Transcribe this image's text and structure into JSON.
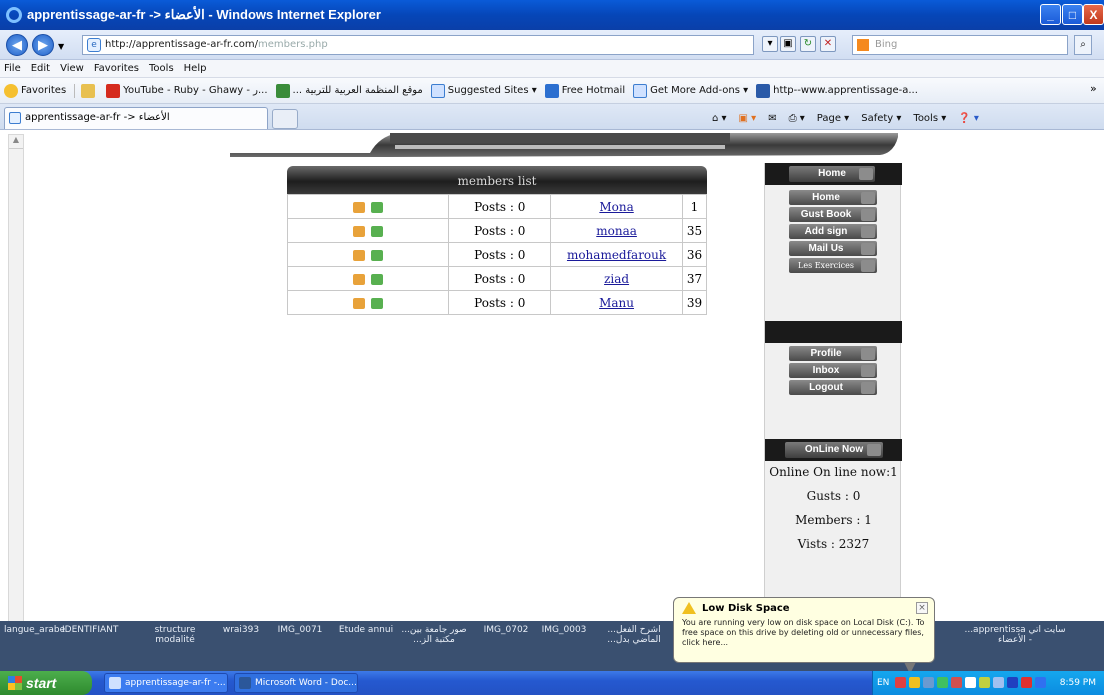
{
  "window": {
    "title": "apprentissage-ar-fr -> الأعضاء - Windows Internet Explorer",
    "minimize": "_",
    "maximize": "□",
    "close": "X"
  },
  "address_bar": {
    "url_host": "http://apprentissage-ar-fr.com/",
    "url_path": "members.php",
    "search_placeholder": "Bing"
  },
  "menu": [
    "File",
    "Edit",
    "View",
    "Favorites",
    "Tools",
    "Help"
  ],
  "favorites_bar": {
    "favorites_label": "Favorites",
    "items": [
      "YouTube - Ruby - Ghawy - ر...",
      "... موقع المنظمة العربية للتربية",
      "Suggested Sites ▾",
      "Free Hotmail",
      "Get More Add-ons ▾",
      "http--www.apprentissage-a..."
    ],
    "overflow": "»"
  },
  "tab": {
    "label": "apprentissage-ar-fr -> الأعضاء"
  },
  "command_bar": [
    "Page ▾",
    "Safety ▾",
    "Tools ▾"
  ],
  "members": {
    "header": "members list",
    "rows": [
      {
        "posts": "Posts : 0",
        "name": "Mona",
        "id": "1"
      },
      {
        "posts": "Posts : 0",
        "name": "monaa",
        "id": "35"
      },
      {
        "posts": "Posts : 0",
        "name": "mohamedfarouk",
        "id": "36"
      },
      {
        "posts": "Posts : 0",
        "name": "ziad",
        "id": "37"
      },
      {
        "posts": "Posts : 0",
        "name": "Manu",
        "id": "39"
      }
    ]
  },
  "sidebar": {
    "home_header": "Home",
    "nav": [
      "Home",
      "Gust Book",
      "Add sign",
      "Mail Us",
      "Les Exercices"
    ],
    "user_menu": [
      "Profile",
      "Inbox",
      "Logout"
    ],
    "online_header": "OnLine Now",
    "online_now": "Online On line now:1",
    "gusts": "Gusts : 0",
    "members": "Members : 1",
    "visits": "Vists : 2327"
  },
  "desktop_icons": [
    "langue_arabe",
    "IDENTIFIANT",
    "structure\nmodalité",
    "wrai393",
    "IMG_0071",
    "Etude annui",
    "...صور جامعة بين\n...مكتبة الز",
    "IMG_0702",
    "IMG_0003",
    "...اشرح الفعل\n...الماضي بدل",
    "...apprentissa سايت اتي\nالأعضاء -"
  ],
  "balloon": {
    "title": "Low Disk Space",
    "message": "You are running very low on disk space on Local Disk (C:). To free space on this drive by deleting old or unnecessary files, click here...",
    "close": "×"
  },
  "taskbar": {
    "start": "start",
    "buttons": [
      "apprentissage-ar-fr -...",
      "Microsoft Word - Doc..."
    ],
    "lang": "EN",
    "time": "8:59 PM"
  }
}
